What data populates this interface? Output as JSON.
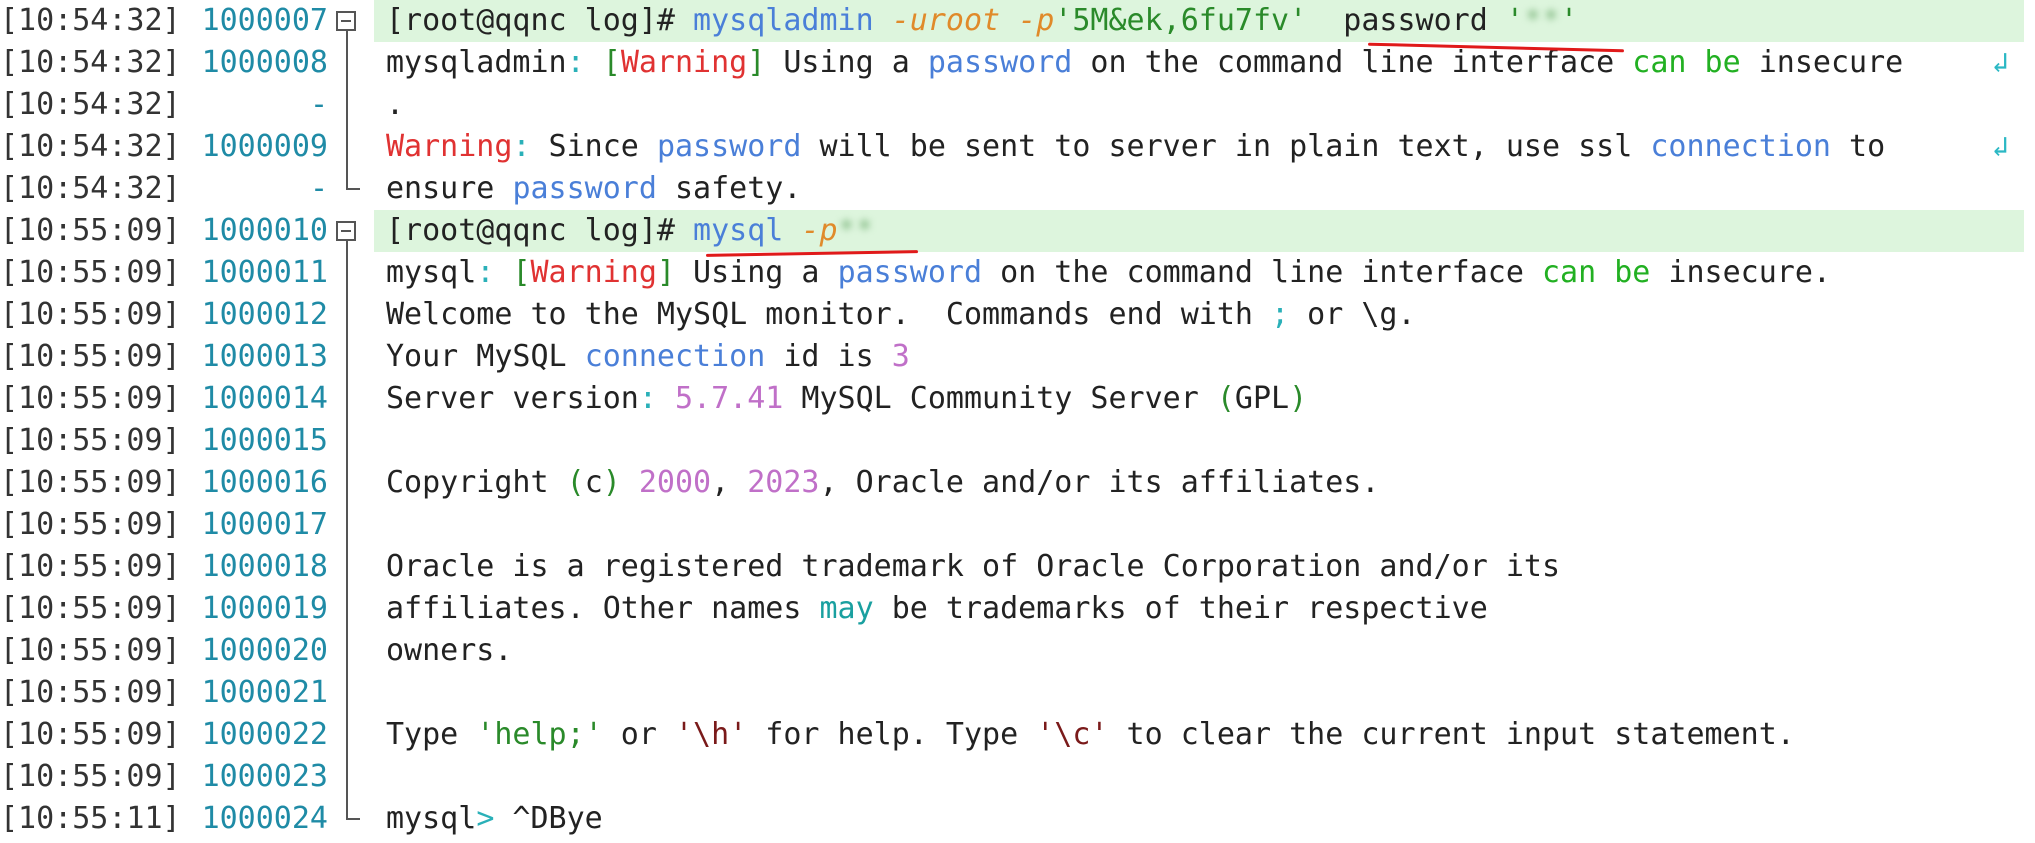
{
  "rows": [
    {
      "ts": "[10:54:32]",
      "ln": "1000007"
    },
    {
      "ts": "[10:54:32]",
      "ln": "1000008"
    },
    {
      "ts": "[10:54:32]",
      "ln": "-"
    },
    {
      "ts": "[10:54:32]",
      "ln": "1000009"
    },
    {
      "ts": "[10:54:32]",
      "ln": "-"
    },
    {
      "ts": "[10:55:09]",
      "ln": "1000010"
    },
    {
      "ts": "[10:55:09]",
      "ln": "1000011"
    },
    {
      "ts": "[10:55:09]",
      "ln": "1000012"
    },
    {
      "ts": "[10:55:09]",
      "ln": "1000013"
    },
    {
      "ts": "[10:55:09]",
      "ln": "1000014"
    },
    {
      "ts": "[10:55:09]",
      "ln": "1000015"
    },
    {
      "ts": "[10:55:09]",
      "ln": "1000016"
    },
    {
      "ts": "[10:55:09]",
      "ln": "1000017"
    },
    {
      "ts": "[10:55:09]",
      "ln": "1000018"
    },
    {
      "ts": "[10:55:09]",
      "ln": "1000019"
    },
    {
      "ts": "[10:55:09]",
      "ln": "1000020"
    },
    {
      "ts": "[10:55:09]",
      "ln": "1000021"
    },
    {
      "ts": "[10:55:09]",
      "ln": "1000022"
    },
    {
      "ts": "[10:55:09]",
      "ln": "1000023"
    },
    {
      "ts": "[10:55:11]",
      "ln": "1000024"
    }
  ],
  "lines": {
    "l0": {
      "prompt": "[root@qqnc log]# ",
      "cmd": "mysqladmin",
      "sp1": " ",
      "opt1": "-uroot",
      "sp2": " ",
      "opt2": "-p",
      "pw": "'5M&ek,6fu7fv'",
      "sp3": "  ",
      "arg": "password",
      "sp4": " ",
      "q1": "'",
      "blurred": "**",
      "q2": "'"
    },
    "l1": {
      "a": "mysqladmin",
      "colon": ":",
      "sp": " ",
      "lb": "[",
      "warn": "Warning",
      "rb": "]",
      "t1": " Using a ",
      "pw": "password",
      "t2": " on the command line interface ",
      "can": "can",
      "sp2": " ",
      "be": "be",
      "t3": " insecure"
    },
    "l2": {
      "text": "."
    },
    "l3": {
      "warn": "Warning",
      "colon": ":",
      "t1": " Since ",
      "pw": "password",
      "t2": " will be sent to server in plain text, use ssl ",
      "conn": "connection",
      "t3": " to"
    },
    "l4": {
      "t1": "ensure ",
      "pw": "password",
      "t2": " safety."
    },
    "l5": {
      "prompt": "[root@qqnc log]# ",
      "cmd": "mysql",
      "sp": " ",
      "opt": "-p",
      "blurred": "**"
    },
    "l6": {
      "a": "mysql",
      "colon": ":",
      "sp": " ",
      "lb": "[",
      "warn": "Warning",
      "rb": "]",
      "t1": " Using a ",
      "pw": "password",
      "t2": " on the command line interface ",
      "can": "can",
      "sp2": " ",
      "be": "be",
      "t3": " insecure."
    },
    "l7": {
      "t1": "Welcome to the MySQL monitor.  Commands end with ",
      "semi": ";",
      "t2": " or \\g."
    },
    "l8": {
      "t1": "Your MySQL ",
      "conn": "connection",
      "t2": " id is ",
      "num": "3"
    },
    "l9": {
      "t1": "Server version",
      "colon": ":",
      "sp": " ",
      "ver": "5.7.41",
      "t2": " MySQL Community Server ",
      "lp": "(",
      "gpl": "GPL",
      "rp": ")"
    },
    "l10": {
      "text": ""
    },
    "l11": {
      "t1": "Copyright ",
      "lp": "(",
      "c": "c",
      "rp": ")",
      "sp": " ",
      "y1": "2000",
      "comma": ", ",
      "y2": "2023",
      "t2": ", Oracle and/or its affiliates."
    },
    "l12": {
      "text": ""
    },
    "l13": {
      "text": "Oracle is a registered trademark of Oracle Corporation and/or its"
    },
    "l14": {
      "t1": "affiliates. Other names ",
      "may": "may",
      "t2": " be trademarks of their respective"
    },
    "l15": {
      "text": "owners."
    },
    "l16": {
      "text": ""
    },
    "l17": {
      "t1": "Type ",
      "s1": "'help;'",
      "t2": " or ",
      "s2": "'\\h'",
      "t3": " for help. Type ",
      "s3": "'\\c'",
      "t4": " to clear the current input statement."
    },
    "l18": {
      "text": ""
    },
    "l19": {
      "a": "mysql",
      "gt": ">",
      "t1": " ^DBye"
    }
  },
  "wrap_icon": "↲",
  "colors": {
    "highlight": "#ddf5dd",
    "underline": "#e01a1a",
    "line_number": "#1f8ba6"
  }
}
